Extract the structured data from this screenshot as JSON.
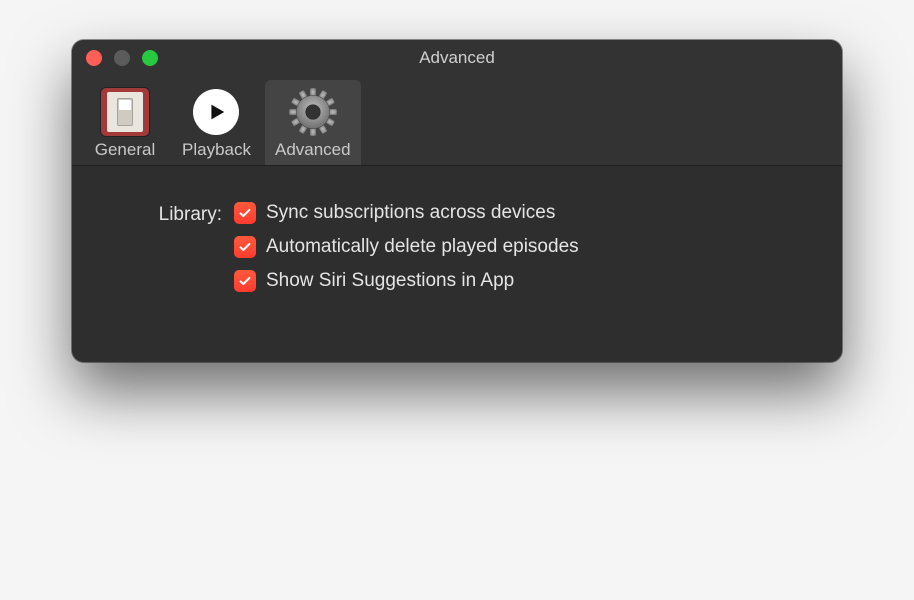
{
  "window": {
    "title": "Advanced"
  },
  "tabs": {
    "general": {
      "label": "General"
    },
    "playback": {
      "label": "Playback"
    },
    "advanced": {
      "label": "Advanced"
    }
  },
  "content": {
    "section_label": "Library:",
    "options": {
      "sync": {
        "label": "Sync subscriptions across devices",
        "checked": true
      },
      "delete": {
        "label": "Automatically delete played episodes",
        "checked": true
      },
      "siri": {
        "label": "Show Siri Suggestions in App",
        "checked": true
      }
    }
  }
}
